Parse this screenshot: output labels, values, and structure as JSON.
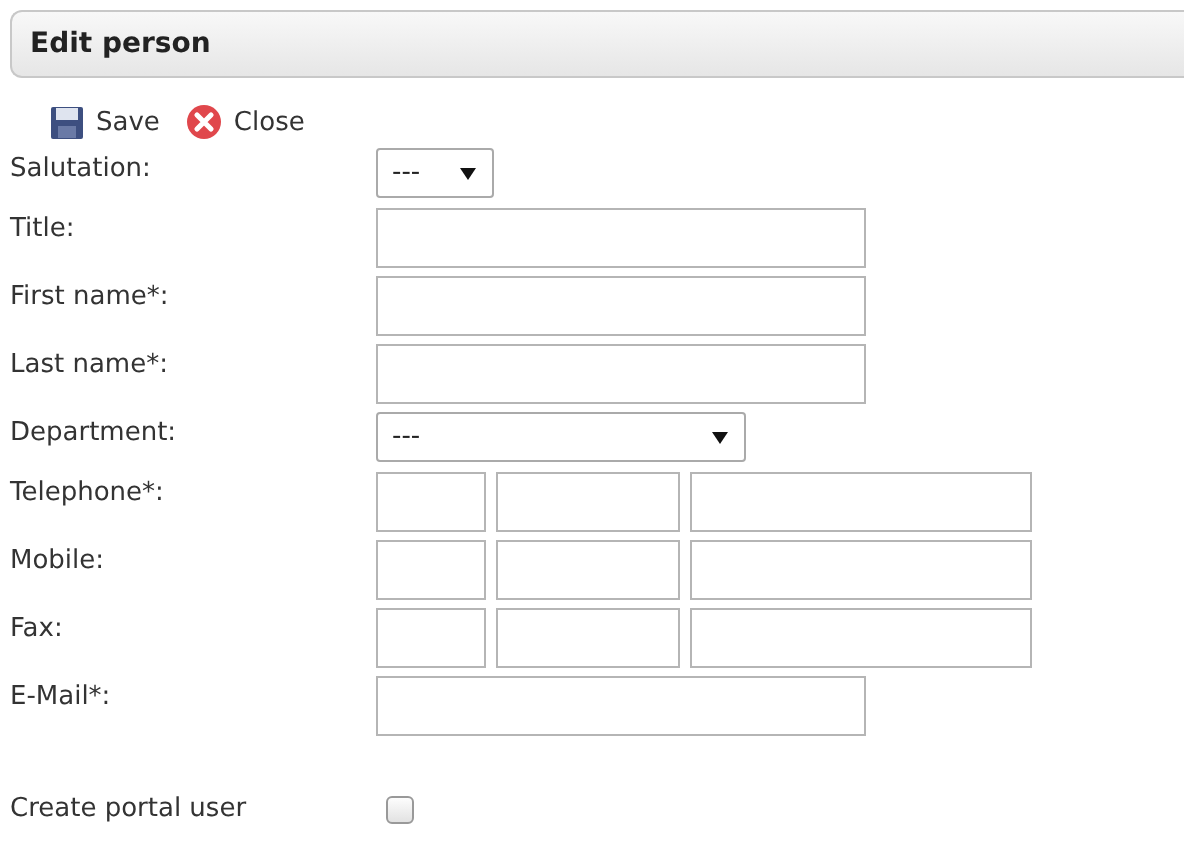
{
  "header": {
    "title": "Edit person"
  },
  "toolbar": [
    {
      "kind": "save",
      "label": "Save"
    },
    {
      "kind": "close",
      "label": "Close"
    }
  ],
  "fields": [
    {
      "kind": "short-select",
      "label": "Salutation:",
      "value": "---"
    },
    {
      "kind": "text",
      "label": "Title:"
    },
    {
      "kind": "text",
      "label": "First name*:"
    },
    {
      "kind": "text",
      "label": "Last name*:"
    },
    {
      "kind": "select",
      "label": "Department:",
      "value": "---"
    },
    {
      "kind": "phone",
      "label": "Telephone*:"
    },
    {
      "kind": "phone",
      "label": "Mobile:"
    },
    {
      "kind": "phone",
      "label": "Fax:"
    },
    {
      "kind": "text",
      "label": "E-Mail*:"
    },
    {
      "kind": "checkbox",
      "label": "Create portal user",
      "checked": false
    }
  ]
}
